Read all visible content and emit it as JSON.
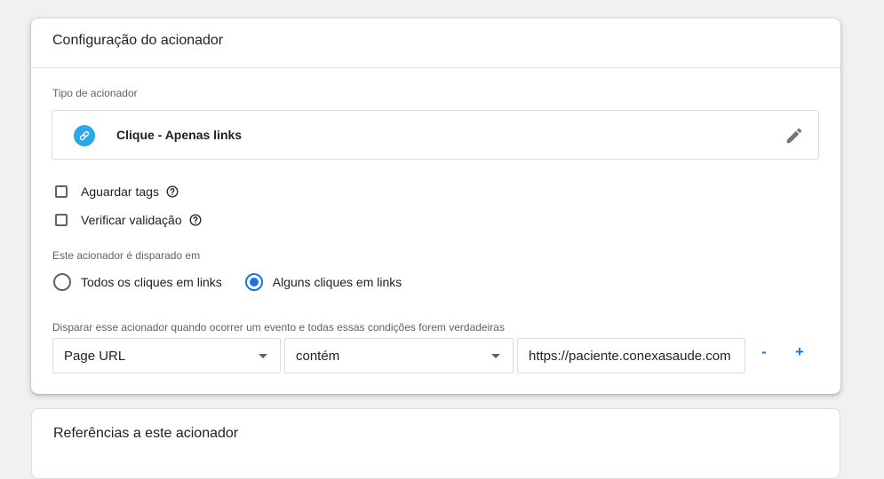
{
  "trigger_config": {
    "title": "Configuração do acionador",
    "type_label": "Tipo de acionador",
    "type_name": "Clique - Apenas links",
    "checkboxes": [
      {
        "label": "Aguardar tags",
        "checked": false
      },
      {
        "label": "Verificar validação",
        "checked": false
      }
    ],
    "fires_on_label": "Este acionador é disparado em",
    "fire_options": [
      {
        "label": "Todos os cliques em links",
        "selected": false
      },
      {
        "label": "Alguns cliques em links",
        "selected": true
      }
    ],
    "condition_label": "Disparar esse acionador quando ocorrer um evento e todas essas condições forem verdadeiras",
    "condition": {
      "variable": "Page URL",
      "operator": "contém",
      "value": "https://paciente.conexasaude.com"
    },
    "remove_label": "-",
    "add_label": "+"
  },
  "references": {
    "title": "Referências a este acionador"
  },
  "colors": {
    "accent": "#1a73e8",
    "link_badge": "#2aa9e8"
  },
  "icons": {
    "type": "link-icon",
    "edit": "pencil-icon",
    "help": "help-circle-icon",
    "dropdown": "caret-down-icon"
  }
}
